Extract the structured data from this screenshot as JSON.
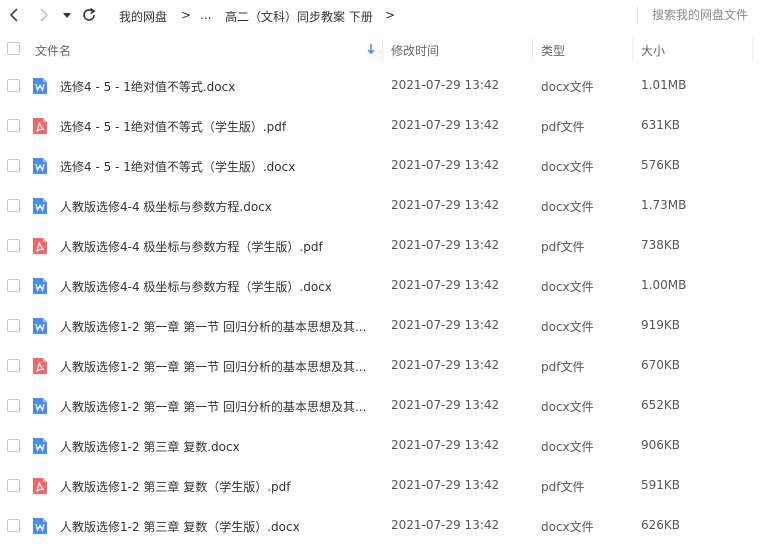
{
  "toolbar": {
    "breadcrumb": {
      "root": "我的网盘",
      "ellipsis": "...",
      "current": "高二（文科）同步教案 下册"
    },
    "separator": ">",
    "search_placeholder": "搜索我的网盘文件"
  },
  "columns": {
    "name": "文件名",
    "modified": "修改时间",
    "type": "类型",
    "size": "大小"
  },
  "colors": {
    "docx_icon": "#4a8cf7",
    "pdf_icon": "#f2686a",
    "sort_arrow": "#3b82f6"
  },
  "files": [
    {
      "name": "选修4 - 5 - 1绝对值不等式.docx",
      "modified": "2021-07-29 13:42",
      "type": "docx文件",
      "size": "1.01MB",
      "icon": "word-icon"
    },
    {
      "name": "选修4 - 5 - 1绝对值不等式（学生版）.pdf",
      "modified": "2021-07-29 13:42",
      "type": "pdf文件",
      "size": "631KB",
      "icon": "pdf-icon"
    },
    {
      "name": "选修4 - 5 - 1绝对值不等式（学生版）.docx",
      "modified": "2021-07-29 13:42",
      "type": "docx文件",
      "size": "576KB",
      "icon": "word-icon"
    },
    {
      "name": "人教版选修4-4  极坐标与参数方程.docx",
      "modified": "2021-07-29 13:42",
      "type": "docx文件",
      "size": "1.73MB",
      "icon": "word-icon"
    },
    {
      "name": "人教版选修4-4  极坐标与参数方程（学生版）.pdf",
      "modified": "2021-07-29 13:42",
      "type": "pdf文件",
      "size": "738KB",
      "icon": "pdf-icon"
    },
    {
      "name": "人教版选修4-4  极坐标与参数方程（学生版）.docx",
      "modified": "2021-07-29 13:42",
      "type": "docx文件",
      "size": "1.00MB",
      "icon": "word-icon"
    },
    {
      "name": "人教版选修1-2 第一章 第一节  回归分析的基本思想及其...",
      "modified": "2021-07-29 13:42",
      "type": "docx文件",
      "size": "919KB",
      "icon": "word-icon"
    },
    {
      "name": "人教版选修1-2 第一章 第一节  回归分析的基本思想及其...",
      "modified": "2021-07-29 13:42",
      "type": "pdf文件",
      "size": "670KB",
      "icon": "pdf-icon"
    },
    {
      "name": "人教版选修1-2 第一章 第一节  回归分析的基本思想及其...",
      "modified": "2021-07-29 13:42",
      "type": "docx文件",
      "size": "652KB",
      "icon": "word-icon"
    },
    {
      "name": "人教版选修1-2 第三章  复数.docx",
      "modified": "2021-07-29 13:42",
      "type": "docx文件",
      "size": "906KB",
      "icon": "word-icon"
    },
    {
      "name": "人教版选修1-2 第三章  复数（学生版）.pdf",
      "modified": "2021-07-29 13:42",
      "type": "pdf文件",
      "size": "591KB",
      "icon": "pdf-icon"
    },
    {
      "name": "人教版选修1-2 第三章  复数（学生版）.docx",
      "modified": "2021-07-29 13:42",
      "type": "docx文件",
      "size": "626KB",
      "icon": "word-icon"
    }
  ]
}
